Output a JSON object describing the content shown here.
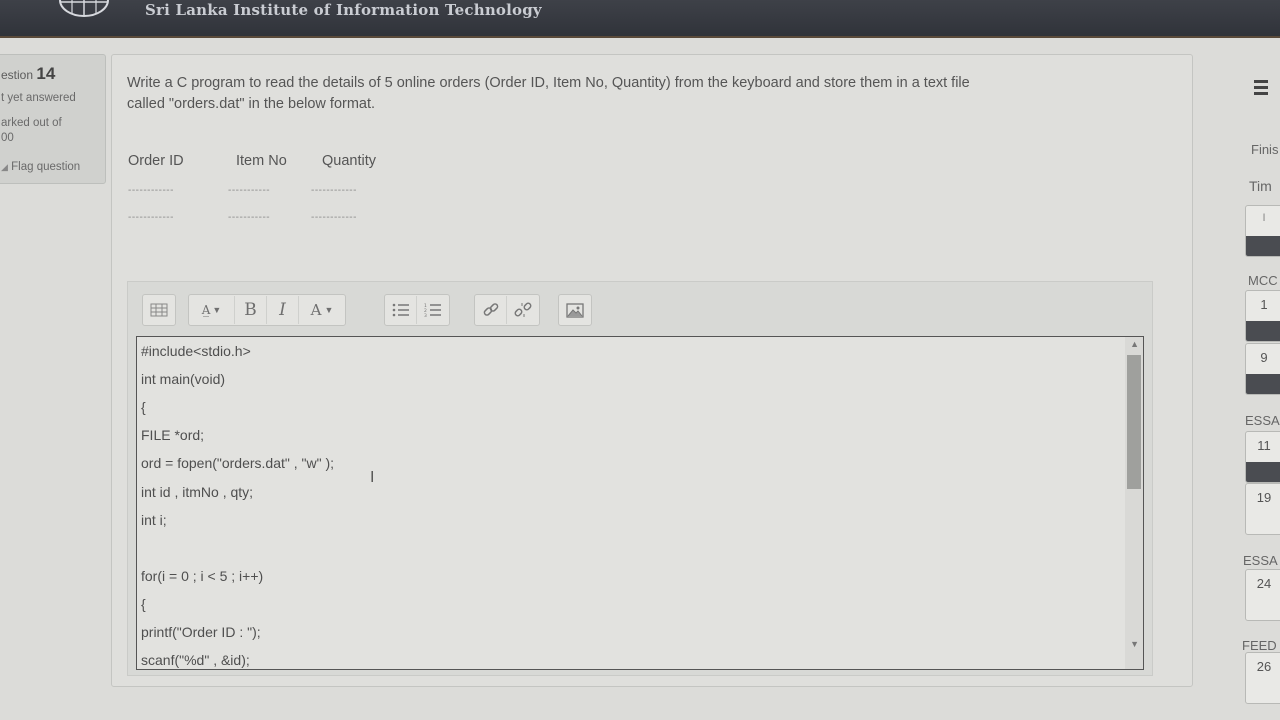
{
  "header": {
    "org_name": "Sri Lanka Institute of Information Technology"
  },
  "question_info": {
    "question_label": "estion",
    "question_number": "14",
    "status": "t yet answered",
    "marked_out_of": "arked out of",
    "marks": "00",
    "flag": "Flag question"
  },
  "question": {
    "line1": "Write a C program to read the details of  5 online orders (Order ID, Item No, Quantity)  from the keyboard and store them in a text file",
    "line2": "called   \"orders.dat\" in the below format.",
    "col_order_id": "Order ID",
    "col_item_no": "Item No",
    "col_quantity": "Quantity",
    "dash1": "------------",
    "dash2": "-----------",
    "dash3": "------------"
  },
  "toolbar": {
    "show_more": "show-more-icon",
    "para_style": "A̲",
    "bold": "B",
    "italic": "I",
    "font_color": "A",
    "unordered_list": "list-icon",
    "ordered_list": "ordered-list-icon",
    "link": "link-icon",
    "unlink": "unlink-icon",
    "image": "image-icon"
  },
  "editor": {
    "lines": [
      "#include<stdio.h>",
      "int main(void)",
      "{",
      "FILE *ord;",
      "ord = fopen(\"orders.dat\" , \"w\" );",
      "int id , itmNo , qty;",
      "int i;",
      "",
      "for(i = 0 ; i < 5 ; i++)",
      "{",
      "printf(\"Order ID : \");",
      "scanf(\"%d\" , &id);"
    ]
  },
  "right_panel": {
    "finish": "Finis",
    "time": "Tim",
    "mcq": "MCC",
    "essay1": "ESSA",
    "essay2": "ESSA",
    "feedback": "FEED",
    "nav": [
      {
        "label": "",
        "answered": true
      },
      {
        "label": "1",
        "answered": true
      },
      {
        "label": "9",
        "answered": true
      },
      {
        "label": "11",
        "answered": true
      },
      {
        "label": "19",
        "answered": false
      },
      {
        "label": "24",
        "answered": false
      },
      {
        "label": "26",
        "answered": false
      }
    ]
  }
}
